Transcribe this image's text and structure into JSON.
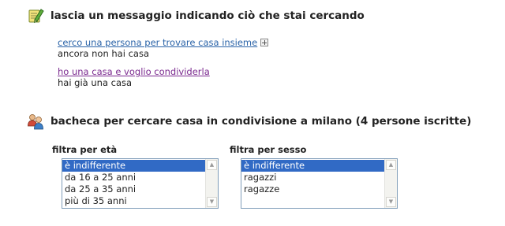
{
  "messages": {
    "heading": "lascia un messaggio indicando ciò che stai cercando",
    "options": [
      {
        "link": "cerco una persona per trovare casa insieme",
        "subtext": "ancora non hai casa"
      },
      {
        "link": "ho una casa e voglio condividerla",
        "subtext": "hai già una casa"
      }
    ]
  },
  "board": {
    "heading": "bacheca per cercare casa in condivisione a milano (4 persone iscritte)"
  },
  "filters": {
    "age": {
      "label": "filtra per età",
      "options": [
        "è indifferente",
        "da 16 a 25 anni",
        "da 25 a 35 anni",
        "più di 35 anni"
      ],
      "selected": "è indifferente"
    },
    "sex": {
      "label": "filtra per sesso",
      "options": [
        "è indifferente",
        "ragazzi",
        "ragazze"
      ],
      "selected": "è indifferente"
    }
  },
  "colors": {
    "link": "#2a63a8",
    "visited_link": "#7b2a8f",
    "selection": "#316ac5"
  },
  "icons": {
    "messages": "note-pencil-icon",
    "board": "people-icon",
    "expand": "plus-box-icon",
    "scroll_up": "chevron-up-icon",
    "scroll_down": "chevron-down-icon"
  }
}
